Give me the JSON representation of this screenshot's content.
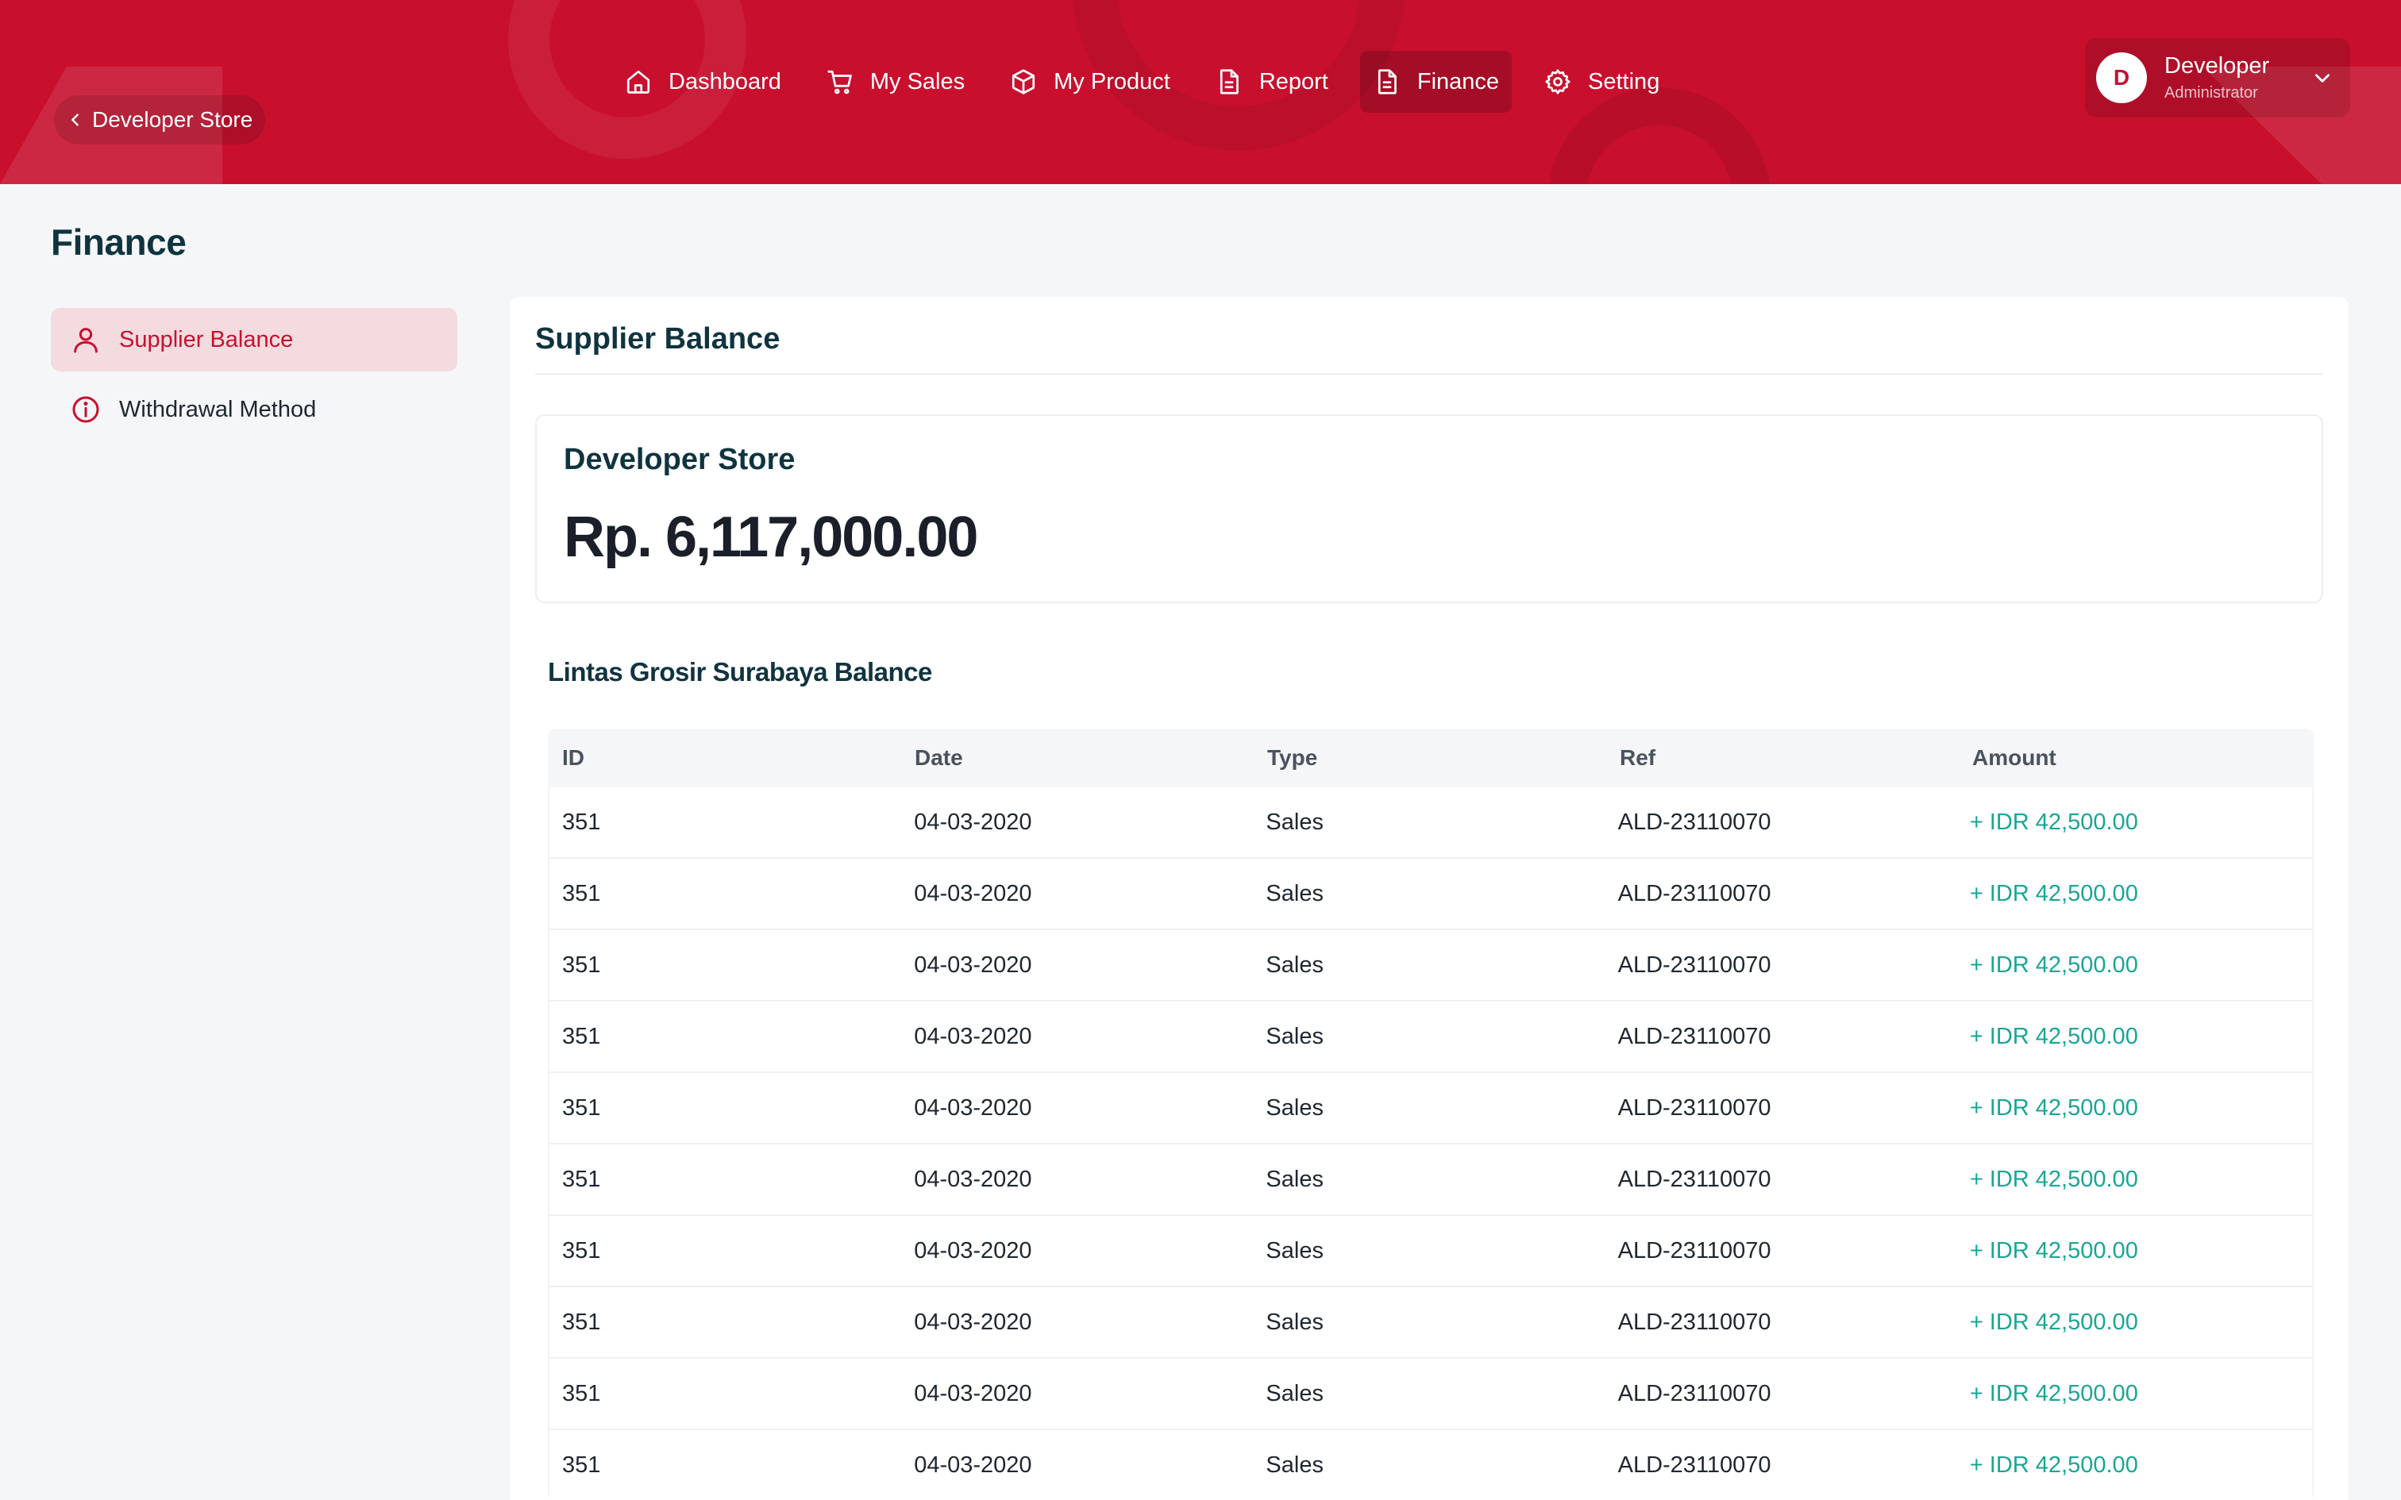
{
  "header": {
    "back_label": "Developer Store",
    "nav": [
      {
        "label": "Dashboard",
        "icon": "home-icon"
      },
      {
        "label": "My Sales",
        "icon": "cart-icon"
      },
      {
        "label": "My Product",
        "icon": "box-icon"
      },
      {
        "label": "Report",
        "icon": "document-icon"
      },
      {
        "label": "Finance",
        "icon": "document-icon",
        "active": true
      },
      {
        "label": "Setting",
        "icon": "gear-icon"
      }
    ],
    "user": {
      "initial": "D",
      "name": "Developer",
      "role": "Administrator"
    }
  },
  "page": {
    "title": "Finance"
  },
  "sidebar": {
    "items": [
      {
        "label": "Supplier Balance",
        "icon": "user-icon",
        "active": true
      },
      {
        "label": "Withdrawal Method",
        "icon": "info-icon",
        "active": false
      }
    ]
  },
  "main": {
    "title": "Supplier Balance",
    "balance": {
      "store": "Developer Store",
      "amount": "Rp. 6,117,000.00"
    },
    "section_title": "Lintas Grosir Surabaya Balance",
    "table": {
      "columns": [
        "ID",
        "Date",
        "Type",
        "Ref",
        "Amount"
      ],
      "rows": [
        [
          "351",
          "04-03-2020",
          "Sales",
          "ALD-23110070",
          "+ IDR 42,500.00"
        ],
        [
          "351",
          "04-03-2020",
          "Sales",
          "ALD-23110070",
          "+ IDR 42,500.00"
        ],
        [
          "351",
          "04-03-2020",
          "Sales",
          "ALD-23110070",
          "+ IDR 42,500.00"
        ],
        [
          "351",
          "04-03-2020",
          "Sales",
          "ALD-23110070",
          "+ IDR 42,500.00"
        ],
        [
          "351",
          "04-03-2020",
          "Sales",
          "ALD-23110070",
          "+ IDR 42,500.00"
        ],
        [
          "351",
          "04-03-2020",
          "Sales",
          "ALD-23110070",
          "+ IDR 42,500.00"
        ],
        [
          "351",
          "04-03-2020",
          "Sales",
          "ALD-23110070",
          "+ IDR 42,500.00"
        ],
        [
          "351",
          "04-03-2020",
          "Sales",
          "ALD-23110070",
          "+ IDR 42,500.00"
        ],
        [
          "351",
          "04-03-2020",
          "Sales",
          "ALD-23110070",
          "+ IDR 42,500.00"
        ],
        [
          "351",
          "04-03-2020",
          "Sales",
          "ALD-23110070",
          "+ IDR 42,500.00"
        ]
      ]
    }
  },
  "colors": {
    "brand": "#c8102e",
    "heading": "#0f3440",
    "positive_amount": "#1aa595",
    "active_bg": "#f4dbe0"
  }
}
